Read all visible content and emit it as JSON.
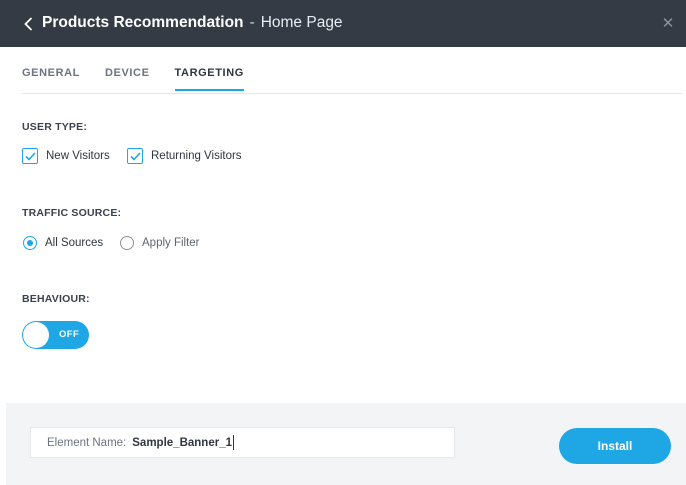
{
  "header": {
    "title": "Products Recommendation",
    "separator": "-",
    "subtitle": "Home Page",
    "back_icon": "chevron-left-icon",
    "close_icon": "close-icon",
    "close_glyph": "✕"
  },
  "tabs": [
    {
      "label": "GENERAL",
      "active": false
    },
    {
      "label": "DEVICE",
      "active": false
    },
    {
      "label": "TARGETING",
      "active": true
    }
  ],
  "user_type": {
    "label": "USER TYPE:",
    "options": [
      {
        "label": "New Visitors",
        "checked": true
      },
      {
        "label": "Returning Visitors",
        "checked": true
      }
    ]
  },
  "traffic_source": {
    "label": "TRAFFIC SOURCE:",
    "options": [
      {
        "label": "All Sources",
        "selected": true
      },
      {
        "label": "Apply Filter",
        "selected": false
      }
    ]
  },
  "behaviour": {
    "label": "BEHAVIOUR:",
    "toggle_text": "OFF",
    "enabled": false
  },
  "footer": {
    "element_name_label": "Element Name:",
    "element_name_value": "Sample_Banner_1",
    "install_label": "Install"
  },
  "colors": {
    "accent": "#1ea7e4",
    "header_bg": "#343b45",
    "footer_bg": "#f3f4f6"
  }
}
